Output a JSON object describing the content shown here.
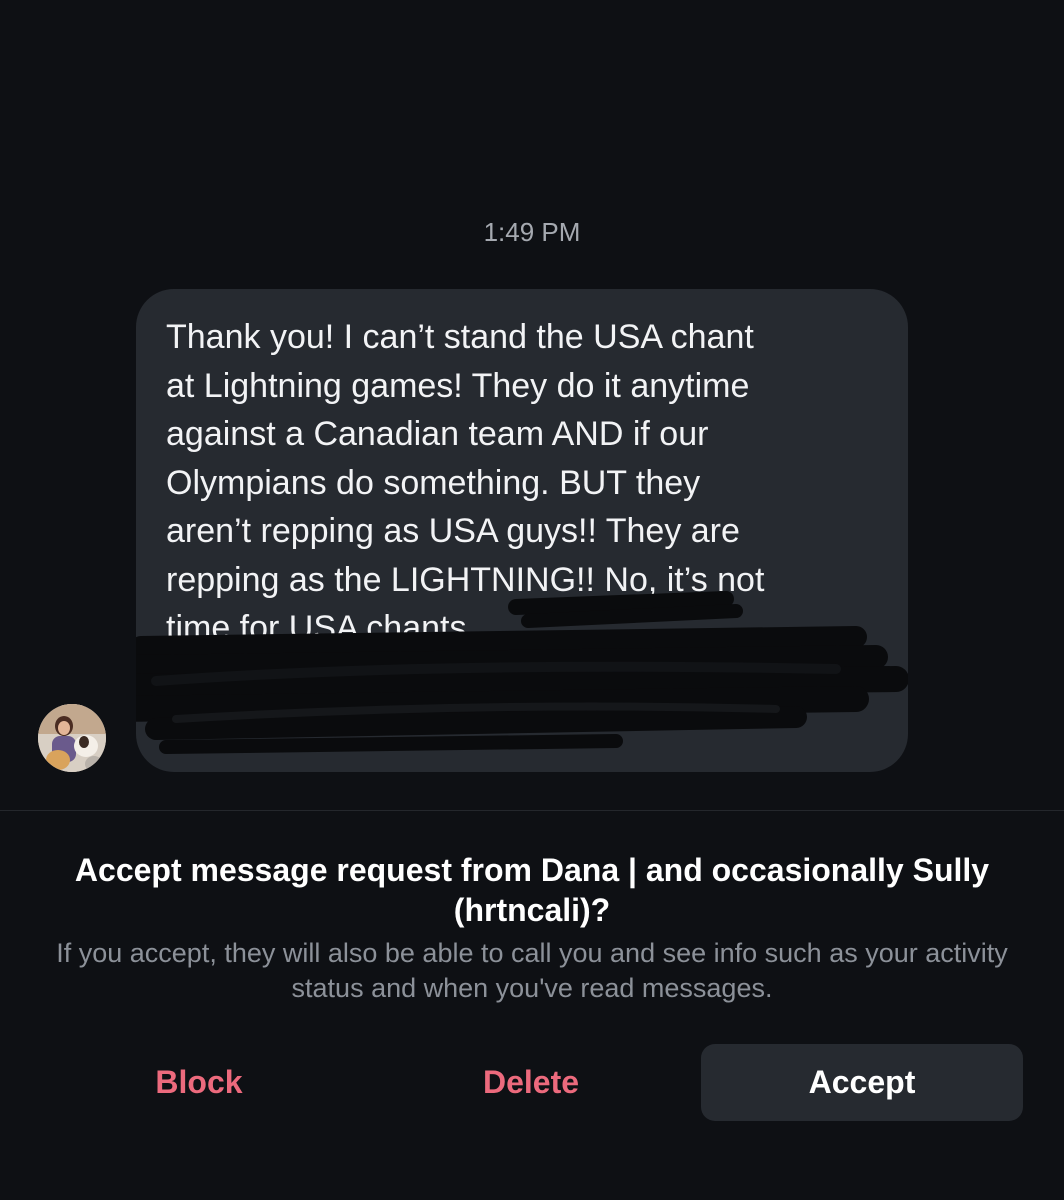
{
  "conversation": {
    "timestamp": "1:49 PM",
    "message": {
      "visible_text": "Thank you! I can’t stand the USA chant\nat Lightning games! They do it anytime\nagainst a Canadian team AND if our\nOlympians do something. BUT they\naren’t repping as USA guys!! They are\nrepping as the LIGHTNING!! No, it’s not\ntime for USA chants.",
      "redacted": true
    },
    "sender_avatar": "profile-photo"
  },
  "request": {
    "title": "Accept message request from Dana | and occasionally Sully (hrtncali)?",
    "description": "If you accept, they will also be able to call you and see info such as your activity status and when you've read messages."
  },
  "actions": {
    "block_label": "Block",
    "delete_label": "Delete",
    "accept_label": "Accept"
  },
  "colors": {
    "background": "#0e1014",
    "bubble": "#262a30",
    "destructive": "#ec6a7d",
    "secondary_text": "#8c9199"
  }
}
